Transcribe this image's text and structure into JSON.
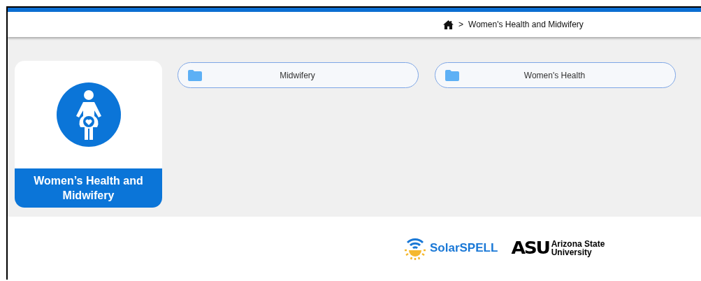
{
  "breadcrumb": {
    "separator": ">",
    "current": "Women's Health and Midwifery"
  },
  "category_card": {
    "title": "Women’s Health and Midwifery"
  },
  "folders": [
    {
      "label": "Midwifery"
    },
    {
      "label": "Women's Health"
    }
  ],
  "footer": {
    "solarspell": "SolarSPELL",
    "asu_mark": "ASU",
    "asu_name_line_1": "Arizona State",
    "asu_name_line_2": "University"
  }
}
